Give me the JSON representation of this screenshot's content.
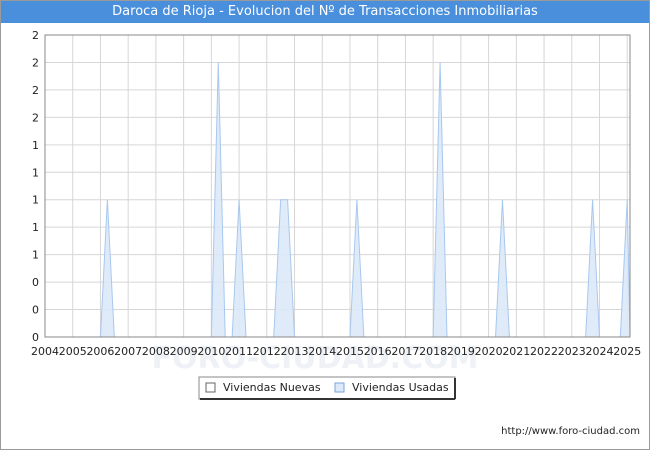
{
  "title": "Daroca de Rioja - Evolucion del Nº de Transacciones Inmobiliarias",
  "footer_url": "http://www.foro-ciudad.com",
  "watermark": "FORO-CIUDAD.COM",
  "chart_data": {
    "type": "area",
    "title": "Daroca de Rioja - Evolucion del Nº de Transacciones Inmobiliarias",
    "xlabel": "",
    "ylabel": "",
    "x_ticks": [
      "2004",
      "2005",
      "2006",
      "2007",
      "2008",
      "2009",
      "2010",
      "2011",
      "2012",
      "2013",
      "2014",
      "2015",
      "2016",
      "2017",
      "2018",
      "2019",
      "2020",
      "2021",
      "2022",
      "2023",
      "2024",
      "2025"
    ],
    "y_tick_labels": [
      "0",
      "0",
      "0",
      "1",
      "1",
      "1",
      "1",
      "1",
      "2",
      "2",
      "2",
      "2"
    ],
    "ylim": [
      0,
      2.2
    ],
    "grid": true,
    "legend_position": "bottom",
    "series": [
      {
        "name": "Viviendas Nuevas",
        "color": "#ffffff",
        "x": [
          2004.0,
          2025.1
        ],
        "y": [
          0,
          0
        ]
      },
      {
        "name": "Viviendas Usadas",
        "color": "#dbe9f8",
        "stroke": "#a8c8ee",
        "x": [
          2004.0,
          2006.0,
          2006.25,
          2006.5,
          2010.0,
          2010.25,
          2010.5,
          2010.75,
          2011.0,
          2011.25,
          2012.25,
          2012.5,
          2012.75,
          2013.0,
          2015.0,
          2015.25,
          2015.5,
          2018.0,
          2018.25,
          2018.5,
          2020.25,
          2020.5,
          2020.75,
          2023.5,
          2023.75,
          2024.0,
          2024.75,
          2025.0,
          2025.1
        ],
        "y": [
          0,
          0,
          1,
          0,
          0,
          2,
          0,
          0,
          1,
          0,
          0,
          1,
          1,
          0,
          0,
          1,
          0,
          0,
          2,
          0,
          0,
          1,
          0,
          0,
          1,
          0,
          0,
          1,
          0
        ]
      }
    ]
  }
}
